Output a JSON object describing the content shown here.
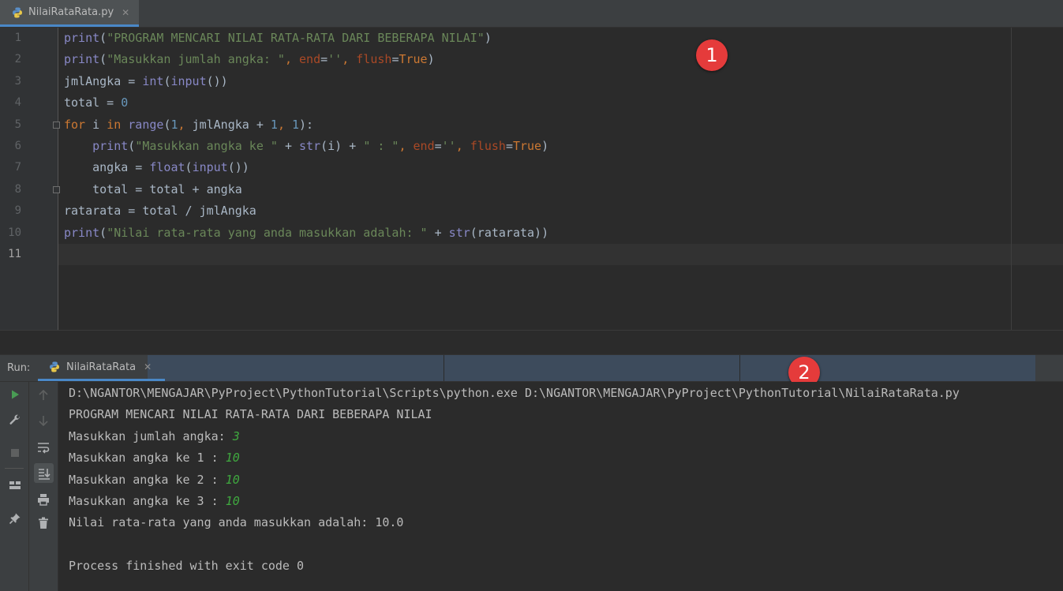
{
  "editor_tab": {
    "filename": "NilaiRataRata.py",
    "close_glyph": "✕",
    "icon": "python-file-icon"
  },
  "editor": {
    "line_numbers": [
      "1",
      "2",
      "3",
      "4",
      "5",
      "6",
      "7",
      "8",
      "9",
      "10",
      "11"
    ],
    "current_line": "11",
    "lines": [
      [
        {
          "t": "print",
          "c": "builtin"
        },
        {
          "t": "(",
          "c": "plain"
        },
        {
          "t": "\"PROGRAM MENCARI NILAI RATA-RATA DARI BEBERAPA NILAI\"",
          "c": "str"
        },
        {
          "t": ")",
          "c": "plain"
        }
      ],
      [
        {
          "t": "print",
          "c": "builtin"
        },
        {
          "t": "(",
          "c": "plain"
        },
        {
          "t": "\"Masukkan jumlah angka: \"",
          "c": "str"
        },
        {
          "t": ", ",
          "c": "kw"
        },
        {
          "t": "end",
          "c": "param"
        },
        {
          "t": "=",
          "c": "plain"
        },
        {
          "t": "''",
          "c": "str"
        },
        {
          "t": ", ",
          "c": "kw"
        },
        {
          "t": "flush",
          "c": "param"
        },
        {
          "t": "=",
          "c": "plain"
        },
        {
          "t": "True",
          "c": "kw"
        },
        {
          "t": ")",
          "c": "plain"
        }
      ],
      [
        {
          "t": "jmlAngka = ",
          "c": "plain"
        },
        {
          "t": "int",
          "c": "builtin"
        },
        {
          "t": "(",
          "c": "plain"
        },
        {
          "t": "input",
          "c": "builtin"
        },
        {
          "t": "())",
          "c": "plain"
        }
      ],
      [
        {
          "t": "total = ",
          "c": "plain"
        },
        {
          "t": "0",
          "c": "num"
        }
      ],
      [
        {
          "t": "for",
          "c": "kw"
        },
        {
          "t": " i ",
          "c": "plain"
        },
        {
          "t": "in",
          "c": "kw"
        },
        {
          "t": " ",
          "c": "plain"
        },
        {
          "t": "range",
          "c": "builtin"
        },
        {
          "t": "(",
          "c": "plain"
        },
        {
          "t": "1",
          "c": "num"
        },
        {
          "t": ", ",
          "c": "kw"
        },
        {
          "t": "jmlAngka + ",
          "c": "plain"
        },
        {
          "t": "1",
          "c": "num"
        },
        {
          "t": ", ",
          "c": "kw"
        },
        {
          "t": "1",
          "c": "num"
        },
        {
          "t": "):",
          "c": "plain"
        }
      ],
      [
        {
          "t": "    ",
          "c": "plain"
        },
        {
          "t": "print",
          "c": "builtin"
        },
        {
          "t": "(",
          "c": "plain"
        },
        {
          "t": "\"Masukkan angka ke \"",
          "c": "str"
        },
        {
          "t": " + ",
          "c": "plain"
        },
        {
          "t": "str",
          "c": "builtin"
        },
        {
          "t": "(i) + ",
          "c": "plain"
        },
        {
          "t": "\" : \"",
          "c": "str"
        },
        {
          "t": ", ",
          "c": "kw"
        },
        {
          "t": "end",
          "c": "param"
        },
        {
          "t": "=",
          "c": "plain"
        },
        {
          "t": "''",
          "c": "str"
        },
        {
          "t": ", ",
          "c": "kw"
        },
        {
          "t": "flush",
          "c": "param"
        },
        {
          "t": "=",
          "c": "plain"
        },
        {
          "t": "True",
          "c": "kw"
        },
        {
          "t": ")",
          "c": "plain"
        }
      ],
      [
        {
          "t": "    angka = ",
          "c": "plain"
        },
        {
          "t": "float",
          "c": "builtin"
        },
        {
          "t": "(",
          "c": "plain"
        },
        {
          "t": "input",
          "c": "builtin"
        },
        {
          "t": "())",
          "c": "plain"
        }
      ],
      [
        {
          "t": "    total = total + angka",
          "c": "plain"
        }
      ],
      [
        {
          "t": "ratarata = total / jmlAngka",
          "c": "plain"
        }
      ],
      [
        {
          "t": "print",
          "c": "builtin"
        },
        {
          "t": "(",
          "c": "plain"
        },
        {
          "t": "\"Nilai rata-rata yang anda masukkan adalah: \"",
          "c": "str"
        },
        {
          "t": " + ",
          "c": "plain"
        },
        {
          "t": "str",
          "c": "builtin"
        },
        {
          "t": "(ratarata))",
          "c": "plain"
        }
      ],
      []
    ]
  },
  "annotations": {
    "editor_badge": "1",
    "console_badge": "2"
  },
  "run_panel": {
    "label": "Run:",
    "tab_label": "NilaiRataRata",
    "close_glyph": "✕",
    "toolbar_left": [
      "run-icon",
      "wrench-icon",
      "stop-icon",
      "layout-icon",
      "pin-icon"
    ],
    "toolbar_right": [
      "scroll-up-icon",
      "scroll-down-icon",
      "soft-wrap-icon",
      "scroll-to-end-icon",
      "print-icon",
      "trash-icon"
    ]
  },
  "console": {
    "lines": [
      [
        {
          "t": "D:\\NGANTOR\\MENGAJAR\\PyProject\\PythonTutorial\\Scripts\\python.exe D:\\NGANTOR\\MENGAJAR\\PyProject\\PythonTutorial\\NilaiRataRata.py",
          "c": "out"
        }
      ],
      [
        {
          "t": "PROGRAM MENCARI NILAI RATA-RATA DARI BEBERAPA NILAI",
          "c": "out"
        }
      ],
      [
        {
          "t": "Masukkan jumlah angka: ",
          "c": "out"
        },
        {
          "t": "3",
          "c": "input"
        }
      ],
      [
        {
          "t": "Masukkan angka ke 1 : ",
          "c": "out"
        },
        {
          "t": "10",
          "c": "input"
        }
      ],
      [
        {
          "t": "Masukkan angka ke 2 : ",
          "c": "out"
        },
        {
          "t": "10",
          "c": "input"
        }
      ],
      [
        {
          "t": "Masukkan angka ke 3 : ",
          "c": "out"
        },
        {
          "t": "10",
          "c": "input"
        }
      ],
      [
        {
          "t": "Nilai rata-rata yang anda masukkan adalah: 10.0",
          "c": "out"
        }
      ],
      [],
      [
        {
          "t": "Process finished with exit code 0",
          "c": "out"
        }
      ]
    ]
  },
  "colors": {
    "background": "#2b2b2b",
    "gutter": "#313335",
    "tab_underline": "#4a88c7",
    "badge": "#e53b3b",
    "user_input": "#3fa83f"
  }
}
